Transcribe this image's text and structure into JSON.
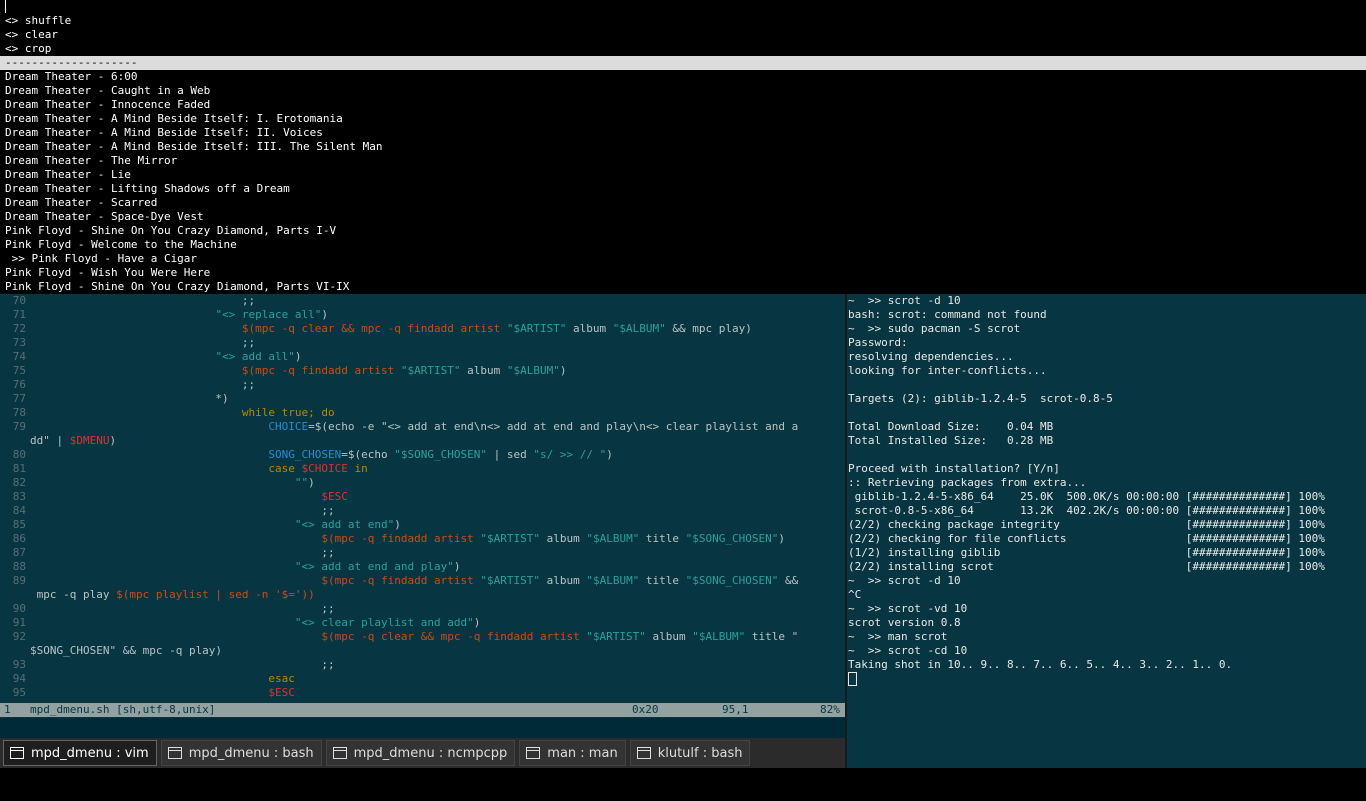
{
  "dmenu": {
    "input": "",
    "options": [
      "<> shuffle",
      "<> clear",
      "<> crop"
    ],
    "separator": "--------------------",
    "songs": [
      "Dream Theater - 6:00",
      "Dream Theater - Caught in a Web",
      "Dream Theater - Innocence Faded",
      "Dream Theater - A Mind Beside Itself: I. Erotomania",
      "Dream Theater - A Mind Beside Itself: II. Voices",
      "Dream Theater - A Mind Beside Itself: III. The Silent Man",
      "Dream Theater - The Mirror",
      "Dream Theater - Lie",
      "Dream Theater - Lifting Shadows off a Dream",
      "Dream Theater - Scarred",
      "Dream Theater - Space-Dye Vest",
      "Pink Floyd - Shine On You Crazy Diamond, Parts I-V",
      "Pink Floyd - Welcome to the Machine",
      " >> Pink Floyd - Have a Cigar",
      "Pink Floyd - Wish You Were Here",
      "Pink Floyd - Shine On You Crazy Diamond, Parts VI-IX"
    ]
  },
  "vim": {
    "lines": [
      {
        "n": "70",
        "t": "                                ;;"
      },
      {
        "n": "71",
        "t": "                            \"<> replace all\")"
      },
      {
        "n": "72",
        "t": "                                $(mpc -q clear && mpc -q findadd artist \"$ARTIST\" album \"$ALBUM\" && mpc play)"
      },
      {
        "n": "73",
        "t": "                                ;;"
      },
      {
        "n": "74",
        "t": "                            \"<> add all\")"
      },
      {
        "n": "75",
        "t": "                                $(mpc -q findadd artist \"$ARTIST\" album \"$ALBUM\")"
      },
      {
        "n": "76",
        "t": "                                ;;"
      },
      {
        "n": "77",
        "t": "                            *)"
      },
      {
        "n": "78",
        "t": "                                while true; do"
      },
      {
        "n": "79",
        "t": "                                    CHOICE=$(echo -e \"<> add at end\\n<> add at end and play\\n<> clear playlist and a"
      },
      {
        "n": "",
        "t": "dd\" | $DMENU)"
      },
      {
        "n": "80",
        "t": "                                    SONG_CHOSEN=$(echo \"$SONG_CHOSEN\" | sed \"s/ >> // \")"
      },
      {
        "n": "81",
        "t": "                                    case $CHOICE in"
      },
      {
        "n": "82",
        "t": "                                        \"\")"
      },
      {
        "n": "83",
        "t": "                                            $ESC"
      },
      {
        "n": "84",
        "t": "                                            ;;"
      },
      {
        "n": "85",
        "t": "                                        \"<> add at end\")"
      },
      {
        "n": "86",
        "t": "                                            $(mpc -q findadd artist \"$ARTIST\" album \"$ALBUM\" title \"$SONG_CHOSEN\")"
      },
      {
        "n": "87",
        "t": "                                            ;;"
      },
      {
        "n": "88",
        "t": "                                        \"<> add at end and play\")"
      },
      {
        "n": "89",
        "t": "                                            $(mpc -q findadd artist \"$ARTIST\" album \"$ALBUM\" title \"$SONG_CHOSEN\" &&"
      },
      {
        "n": "",
        "t": " mpc -q play $(mpc playlist | sed -n '$='))"
      },
      {
        "n": "90",
        "t": "                                            ;;"
      },
      {
        "n": "91",
        "t": "                                        \"<> clear playlist and add\")"
      },
      {
        "n": "92",
        "t": "                                            $(mpc -q clear && mpc -q findadd artist \"$ARTIST\" album \"$ALBUM\" title \""
      },
      {
        "n": "",
        "t": "$SONG_CHOSEN\" && mpc -q play)"
      },
      {
        "n": "93",
        "t": "                                            ;;"
      },
      {
        "n": "94",
        "t": "                                    esac"
      },
      {
        "n": "95",
        "t": "                                    $ESC"
      }
    ],
    "status": {
      "buffer": "1",
      "file": "mpd_dmenu.sh [sh,utf-8,unix]",
      "char": "0x20",
      "position": "95,1",
      "percent": "82%"
    }
  },
  "terminal": {
    "lines": [
      "~  >> scrot -d 10",
      "bash: scrot: command not found",
      "~  >> sudo pacman -S scrot",
      "Password:",
      "resolving dependencies...",
      "looking for inter-conflicts...",
      "",
      "Targets (2): giblib-1.2.4-5  scrot-0.8-5",
      "",
      "Total Download Size:    0.04 MB",
      "Total Installed Size:   0.28 MB",
      "",
      "Proceed with installation? [Y/n]",
      ":: Retrieving packages from extra...",
      " giblib-1.2.4-5-x86_64    25.0K  500.0K/s 00:00:00 [##############] 100%",
      " scrot-0.8-5-x86_64       13.2K  402.2K/s 00:00:00 [##############] 100%",
      "(2/2) checking package integrity                   [##############] 100%",
      "(2/2) checking for file conflicts                  [##############] 100%",
      "(1/2) installing giblib                            [##############] 100%",
      "(2/2) installing scrot                             [##############] 100%",
      "~  >> scrot -d 10",
      "^C",
      "~  >> scrot -vd 10",
      "scrot version 0.8",
      "~  >> man scrot",
      "~  >> scrot -cd 10",
      "Taking shot in 10.. 9.. 8.. 7.. 6.. 5.. 4.. 3.. 2.. 1.. 0."
    ]
  },
  "tabs": [
    {
      "label": "mpd_dmenu : vim",
      "active": true
    },
    {
      "label": "mpd_dmenu : bash",
      "active": false
    },
    {
      "label": "mpd_dmenu : ncmpcpp",
      "active": false
    },
    {
      "label": "man : man",
      "active": false
    },
    {
      "label": "klutulf : bash",
      "active": false
    }
  ]
}
